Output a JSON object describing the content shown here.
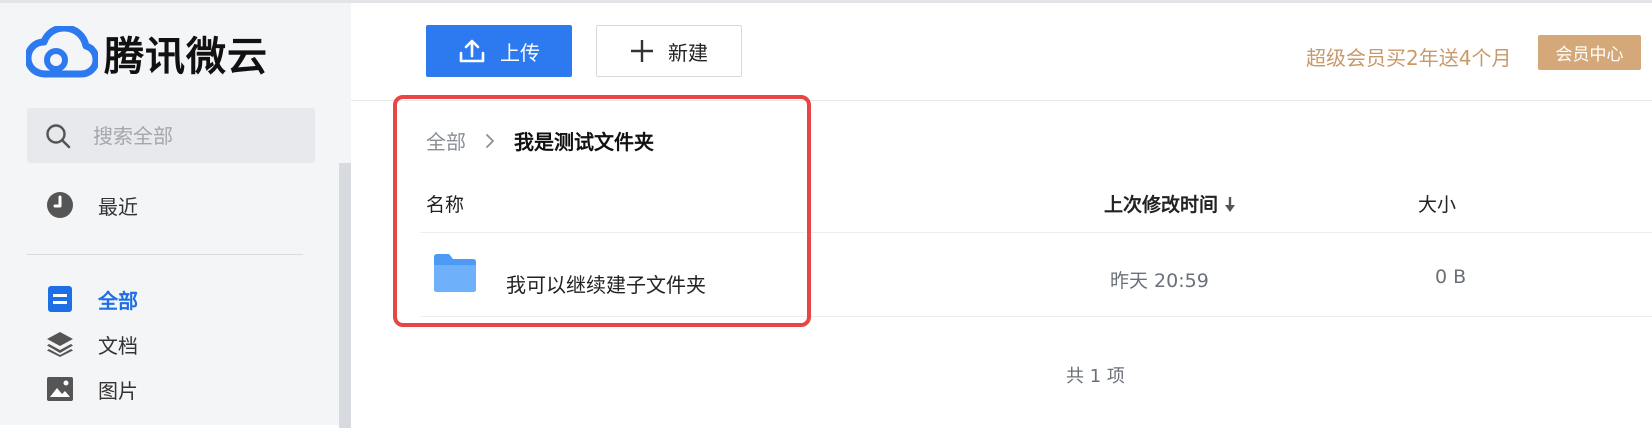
{
  "app": {
    "name": "腾讯微云"
  },
  "sidebar": {
    "search_placeholder": "搜索全部",
    "items": [
      {
        "label": "最近",
        "icon": "clock-icon"
      },
      {
        "label": "全部",
        "icon": "document-icon",
        "active": true
      },
      {
        "label": "文档",
        "icon": "layers-icon"
      },
      {
        "label": "图片",
        "icon": "image-icon"
      }
    ]
  },
  "toolbar": {
    "upload_label": "上传",
    "new_label": "新建",
    "promo_text": "超级会员买2年送4个月",
    "vip_button_label": "会员中心"
  },
  "breadcrumb": {
    "root": "全部",
    "current": "我是测试文件夹"
  },
  "table": {
    "headers": {
      "name": "名称",
      "modified": "上次修改时间",
      "size": "大小"
    },
    "rows": [
      {
        "name": "我可以继续建子文件夹",
        "modified": "昨天 20:59",
        "size": "0 B",
        "icon": "folder-icon"
      }
    ],
    "count_text": "共 1 项"
  },
  "colors": {
    "accent": "#2d7af0",
    "active_nav": "#1e6fe5",
    "promo": "#c9996a",
    "vip_button": "#d4a878",
    "highlight": "#e84545",
    "folder": "#4d9af5"
  }
}
